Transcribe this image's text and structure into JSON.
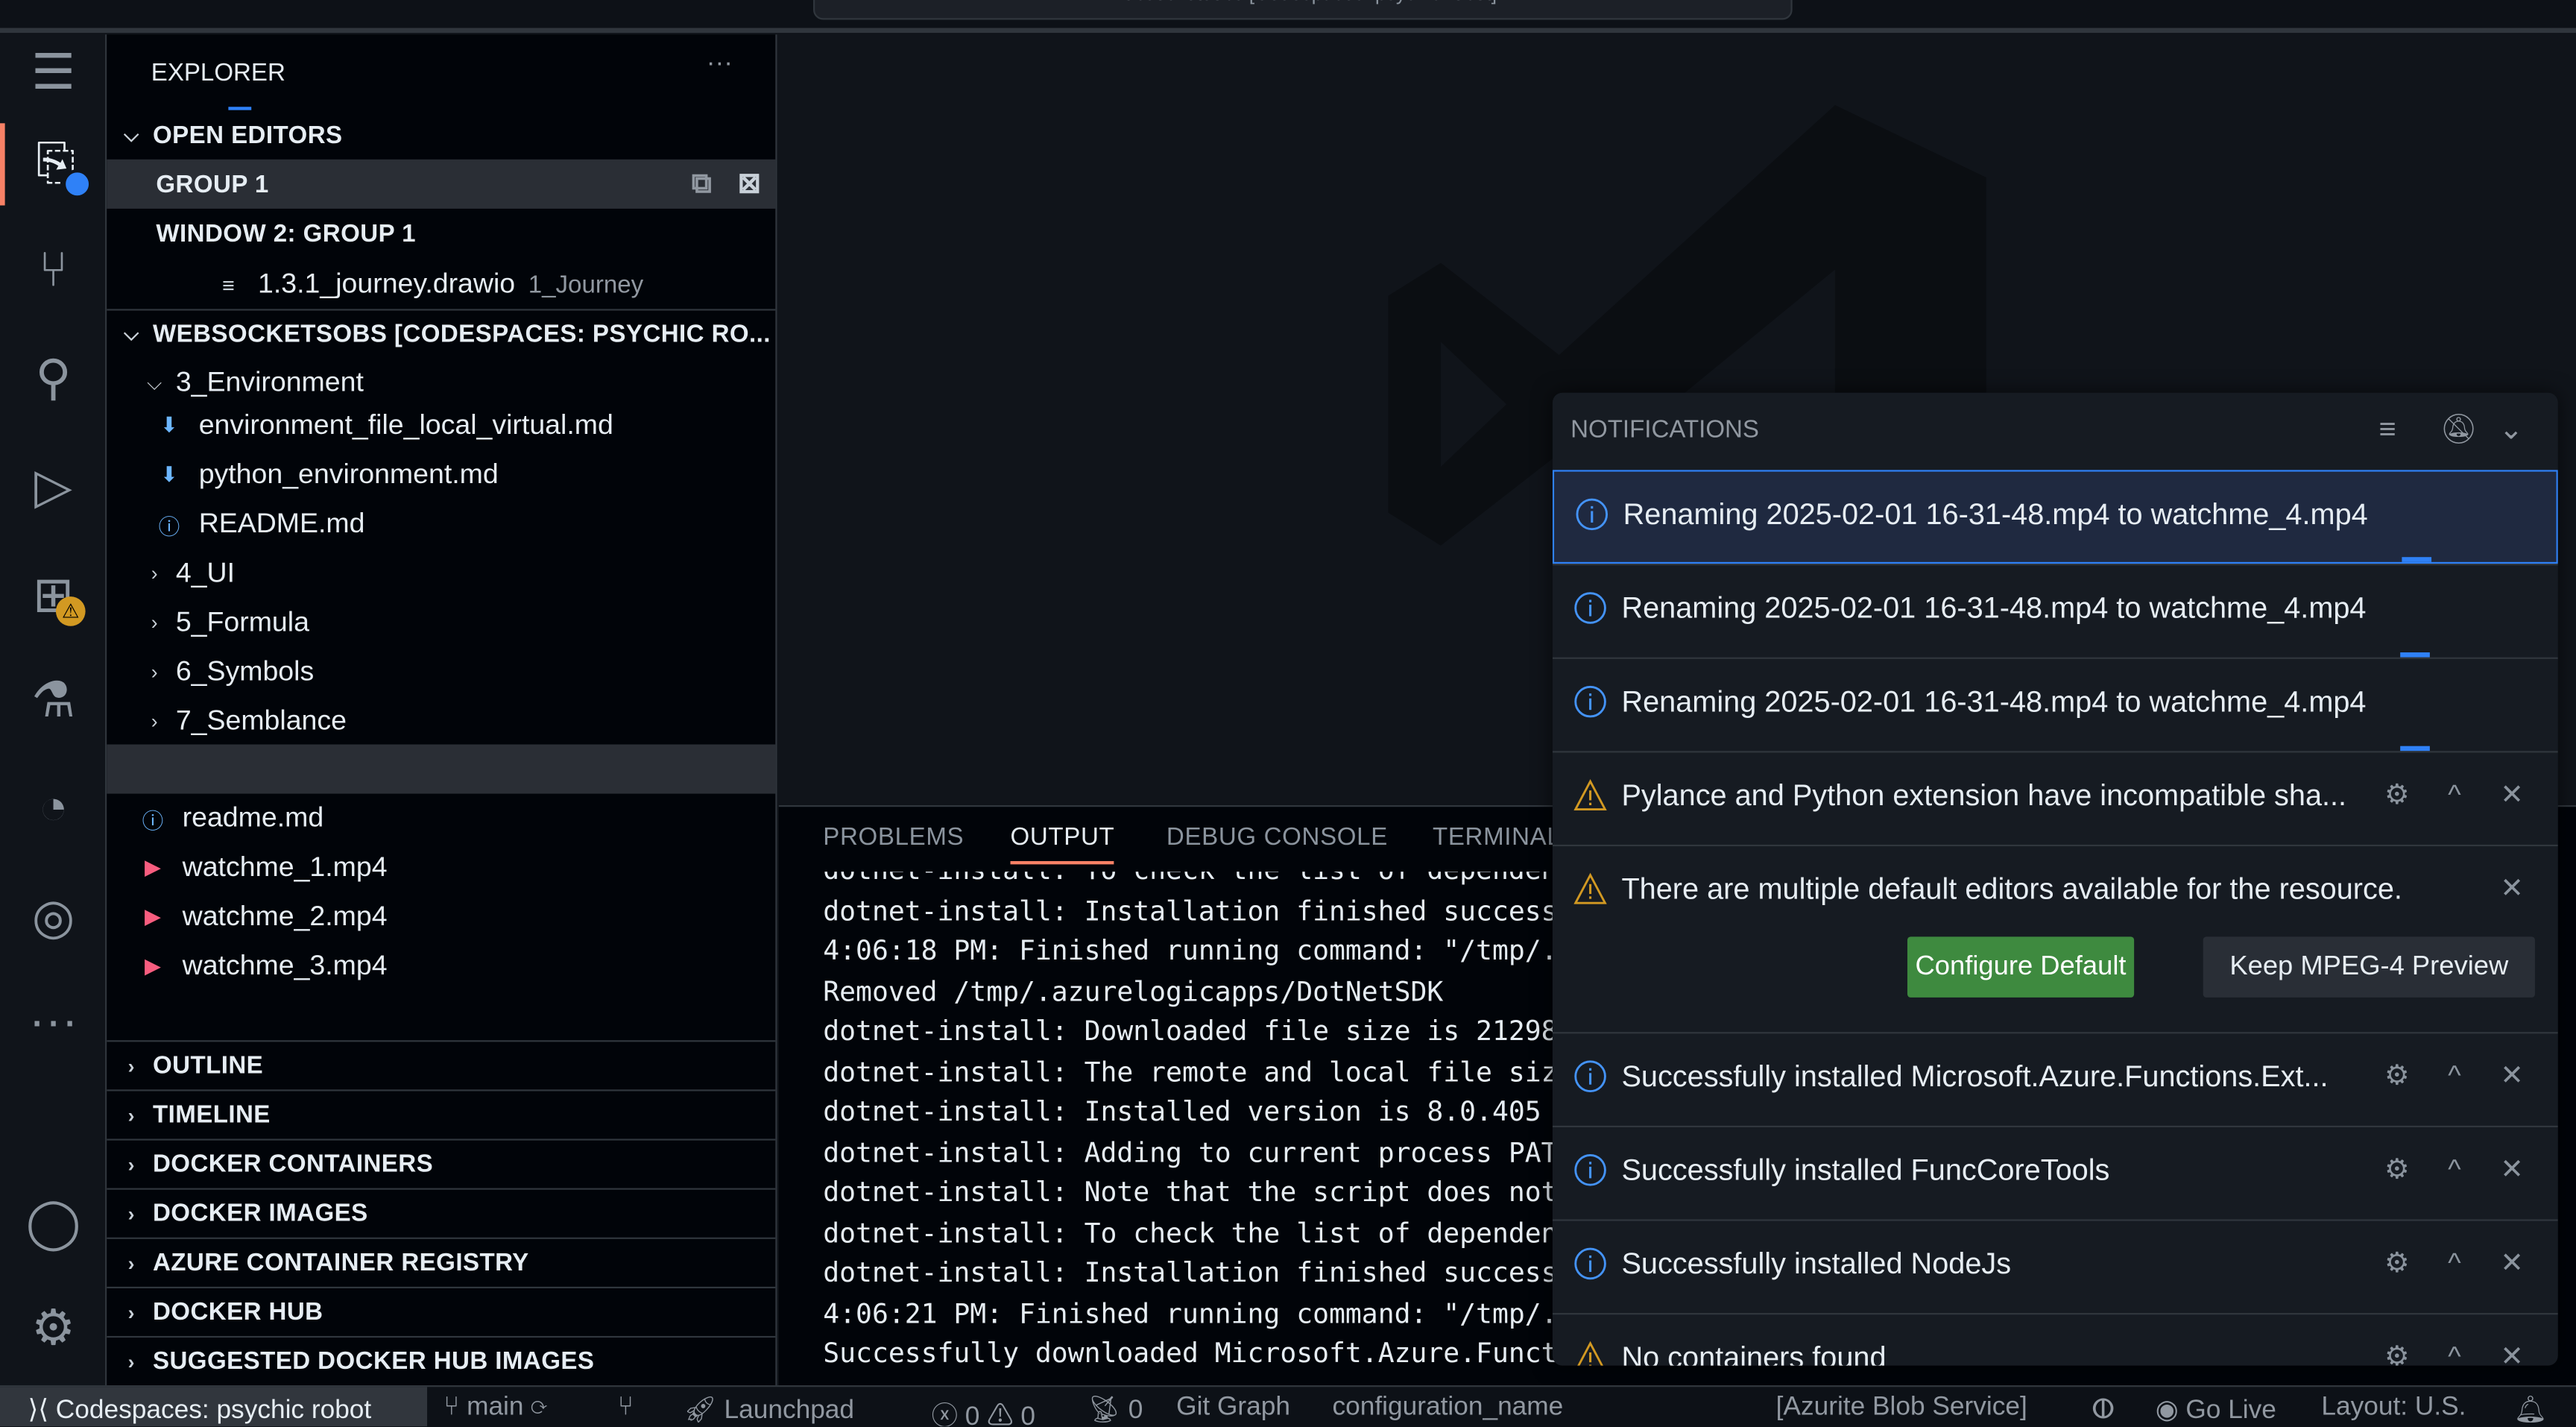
{
  "titlebar": {
    "search_text": "websocketsobs [Codespaces: psychic robot]"
  },
  "activity_bar": {
    "items": [
      "menu-icon",
      "explorer-icon",
      "source-control-icon",
      "search-icon",
      "run-debug-icon",
      "extensions-icon",
      "testing-icon",
      "git-graph-icon",
      "remote-explorer-icon",
      "more-icon",
      "account-icon",
      "settings-icon"
    ],
    "active": "explorer-icon",
    "accent": "#f78166"
  },
  "sidebar": {
    "title": "EXPLORER",
    "more": "···",
    "open_editors": {
      "label": "OPEN EDITORS",
      "groups": [
        {
          "label": "GROUP 1"
        },
        {
          "label": "WINDOW 2: GROUP 1",
          "files": [
            {
              "name": "1.3.1_journey.drawio",
              "desc": "1_Journey"
            }
          ]
        }
      ]
    },
    "workspace": {
      "label": "WEBSOCKETSOBS [CODESPACES: PSYCHIC RO...",
      "items": [
        {
          "name": "3_Environment",
          "type": "folder-open"
        },
        {
          "name": "environment_file_local_virtual.md",
          "type": "download"
        },
        {
          "name": "python_environment.md",
          "type": "download"
        },
        {
          "name": "README.md",
          "type": "info"
        },
        {
          "name": "4_UI",
          "type": "folder"
        },
        {
          "name": "5_Formula",
          "type": "folder"
        },
        {
          "name": "6_Symbols",
          "type": "folder"
        },
        {
          "name": "7_Semblance",
          "type": "folder"
        },
        {
          "name": "",
          "type": "selected"
        },
        {
          "name": "readme.md",
          "type": "info"
        },
        {
          "name": "watchme_1.mp4",
          "type": "video"
        },
        {
          "name": "watchme_2.mp4",
          "type": "video"
        },
        {
          "name": "watchme_3.mp4",
          "type": "video"
        }
      ]
    },
    "sections": [
      "OUTLINE",
      "TIMELINE",
      "DOCKER CONTAINERS",
      "DOCKER IMAGES",
      "AZURE CONTAINER REGISTRY",
      "DOCKER HUB",
      "SUGGESTED DOCKER HUB IMAGES"
    ]
  },
  "panel": {
    "tabs": [
      "PROBLEMS",
      "OUTPUT",
      "DEBUG CONSOLE",
      "TERMINAL"
    ],
    "active_tab": "OUTPUT",
    "lines": [
      "dotnet-install: To check the list of dependen",
      "dotnet-install: Installation finished success",
      "4:06:18 PM: Finished running command: \"/tmp/.",
      "Removed /tmp/.azurelogicapps/DotNetSDK",
      "dotnet-install: Downloaded file size is 21298",
      "dotnet-install: The remote and local file siz",
      "dotnet-install: Installed version is 8.0.405",
      "dotnet-install: Adding to current process PAT",
      "dotnet-install: Note that the script does not",
      "dotnet-install: To check the list of dependen",
      "dotnet-install: Installation finished success",
      "4:06:21 PM: Finished running command: \"/tmp/.",
      "Successfully downloaded Microsoft.Azure.Functi"
    ]
  },
  "notifications": {
    "title": "NOTIFICATIONS",
    "items": [
      {
        "type": "info",
        "message": "Renaming 2025-02-01 16-31-48.mp4 to watchme_4.mp4",
        "focused": true,
        "progress": true
      },
      {
        "type": "info",
        "message": "Renaming 2025-02-01 16-31-48.mp4 to watchme_4.mp4",
        "progress": true
      },
      {
        "type": "info",
        "message": "Renaming 2025-02-01 16-31-48.mp4 to watchme_4.mp4",
        "progress": true
      },
      {
        "type": "warning",
        "message": "Pylance and Python extension have incompatible sha...",
        "actions": true
      },
      {
        "type": "warning",
        "message": "There are multiple default editors available for the resource.",
        "buttons": [
          "Configure Default",
          "Keep MPEG-4 Preview"
        ]
      },
      {
        "type": "info",
        "message": "Successfully installed Microsoft.Azure.Functions.Ext...",
        "actions": true
      },
      {
        "type": "info",
        "message": "Successfully installed FuncCoreTools",
        "actions": true
      },
      {
        "type": "info",
        "message": "Successfully installed NodeJs",
        "actions": true
      },
      {
        "type": "warning",
        "message": "No containers found",
        "actions": true
      }
    ],
    "colors": {
      "info": "#4493f8",
      "warning": "#d29922",
      "primary_button": "#3e8a3f"
    }
  },
  "statusbar": {
    "remote": "Codespaces: psychic robot",
    "branch": "main",
    "launchpad": "Launchpad",
    "errors": "0",
    "warnings": "0",
    "ports": "0",
    "git_graph": "Git Graph",
    "config": "configuration_name",
    "azurite": "[Azurite Blob Service]",
    "go_live": "Go Live",
    "layout": "Layout: U.S."
  }
}
